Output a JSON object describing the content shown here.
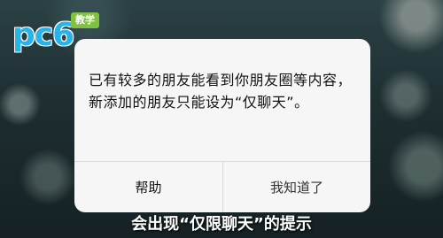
{
  "watermark": {
    "logo_text": "pc6",
    "badge": "教学",
    "logo_color": "#27b4ea",
    "badge_color": "#7fc241"
  },
  "dialog": {
    "message": "已有较多的朋友能看到你朋友圈等内容，新添加的朋友只能设为“仅聊天”。",
    "help_button": "帮助",
    "ok_button": "我知道了"
  },
  "caption": "会出现“仅限聊天”的提示"
}
